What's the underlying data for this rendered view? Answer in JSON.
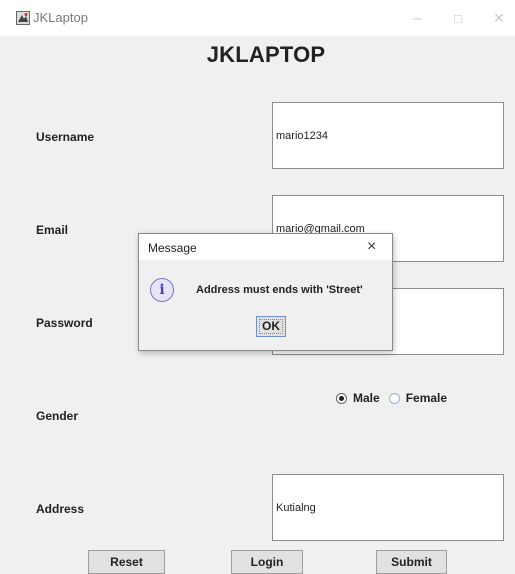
{
  "window": {
    "title": "JKLaptop",
    "minimize_glyph": "–",
    "maximize_glyph": "□",
    "close_glyph": "×",
    "icon": "java-app-icon"
  },
  "form": {
    "heading": "JKLAPTOP",
    "username_label": "Username",
    "username_value": "mario1234",
    "email_label": "Email",
    "email_value": "mario@gmail.com",
    "password_label": "Password",
    "password_value": "",
    "gender_label": "Gender",
    "gender_options": [
      {
        "label": "Male",
        "selected": true
      },
      {
        "label": "Female",
        "selected": false
      }
    ],
    "address_label": "Address",
    "address_value": "Kutialng",
    "reset_label": "Reset",
    "login_label": "Login",
    "submit_label": "Submit"
  },
  "dialog": {
    "title": "Message",
    "close_glyph": "×",
    "icon": "info-icon",
    "icon_glyph": "i",
    "message": "Address must ends with 'Street'",
    "ok_label": "OK"
  }
}
